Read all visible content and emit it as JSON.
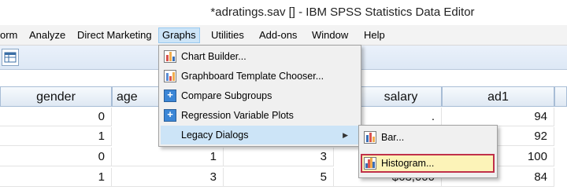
{
  "window": {
    "title": "*adratings.sav [] - IBM SPSS Statistics Data Editor"
  },
  "menubar": {
    "items": [
      {
        "label": "orm"
      },
      {
        "label": "Analyze"
      },
      {
        "label": "Direct Marketing"
      },
      {
        "label": "Graphs"
      },
      {
        "label": "Utilities"
      },
      {
        "label": "Add-ons"
      },
      {
        "label": "Window"
      },
      {
        "label": "Help"
      }
    ]
  },
  "grid": {
    "columns": [
      "gender",
      "age",
      "",
      "salary",
      "ad1"
    ],
    "rows": [
      [
        "0",
        "",
        "",
        ".",
        "94"
      ],
      [
        "1",
        "",
        "",
        "",
        "92"
      ],
      [
        "0",
        "1",
        "3",
        "",
        "100"
      ],
      [
        "1",
        "3",
        "5",
        "$63,000",
        "84"
      ]
    ]
  },
  "graphs_menu": {
    "items": [
      {
        "label": "Chart Builder...",
        "icon": "chart-builder-icon"
      },
      {
        "label": "Graphboard Template Chooser...",
        "icon": "graphboard-icon"
      },
      {
        "label": "Compare Subgroups",
        "icon": "plus-box-icon"
      },
      {
        "label": "Regression Variable Plots",
        "icon": "plus-box-icon"
      },
      {
        "label": "Legacy Dialogs",
        "icon": "",
        "submenu_arrow": "▶"
      }
    ]
  },
  "legacy_submenu": {
    "items": [
      {
        "label": "Bar...",
        "icon": "bar-chart-icon"
      },
      {
        "label": "Histogram...",
        "icon": "histogram-icon"
      }
    ]
  }
}
